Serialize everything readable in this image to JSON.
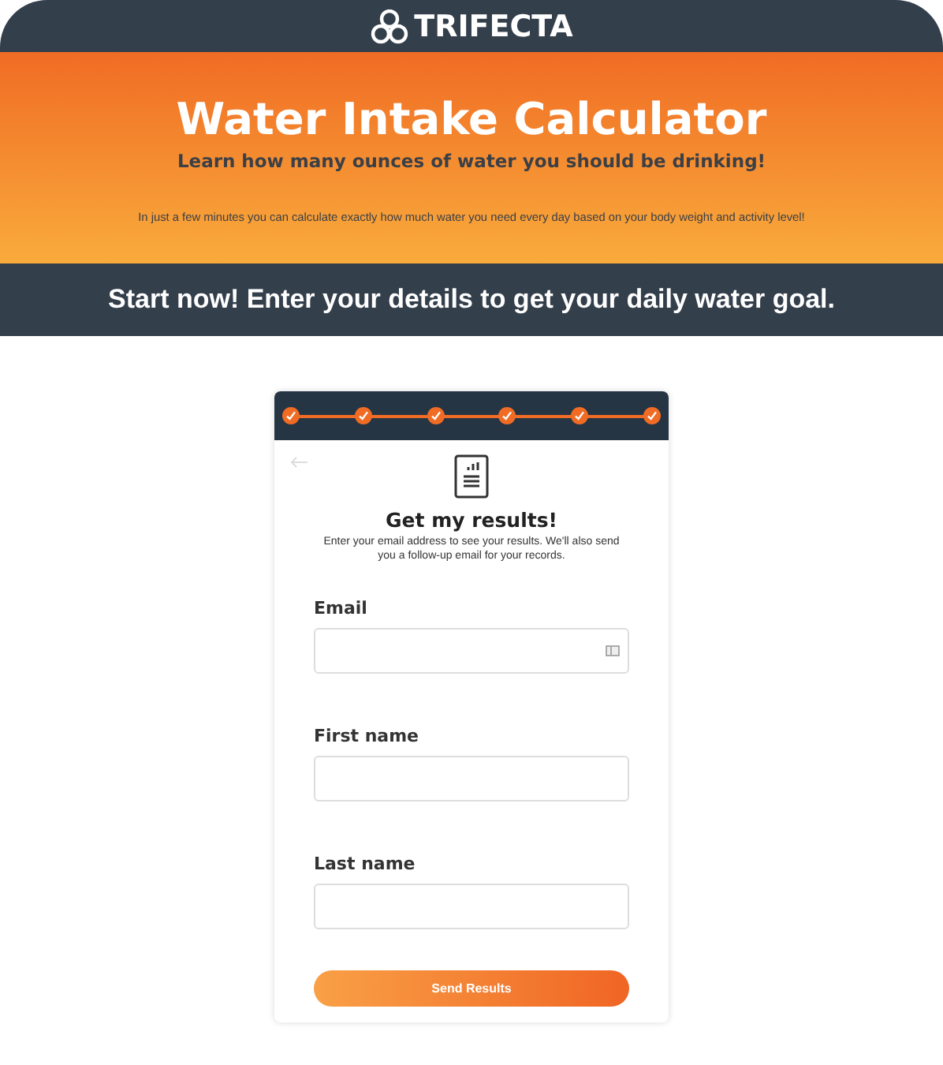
{
  "header": {
    "brand": "TRIFECTA"
  },
  "hero": {
    "title": "Water Intake Calculator",
    "subtitle": "Learn how many ounces of water you should be drinking!",
    "description": "In just a few minutes you can calculate exactly how much water you need every day based on your body weight and activity level!"
  },
  "banner": {
    "text": "Start now! Enter your details to get your daily water goal."
  },
  "form": {
    "steps": [
      {
        "completed": true
      },
      {
        "completed": true
      },
      {
        "completed": true
      },
      {
        "completed": true
      },
      {
        "completed": true
      },
      {
        "completed": true
      }
    ],
    "title": "Get my results!",
    "description": "Enter your email address to see your results. We'll also send you a follow-up email for your records.",
    "fields": [
      {
        "label": "Email",
        "autofill_icon": true
      },
      {
        "label": "First name",
        "autofill_icon": false
      },
      {
        "label": "Last name",
        "autofill_icon": false
      }
    ],
    "submit": "Send Results"
  }
}
